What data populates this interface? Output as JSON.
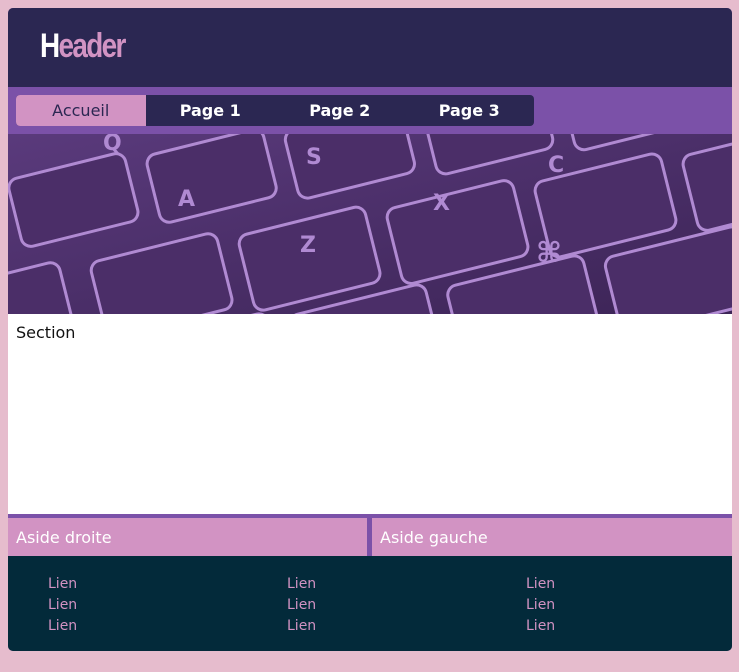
{
  "header": {
    "logo_first": "H",
    "logo_rest": "eader"
  },
  "nav": {
    "items": [
      {
        "label": "Accueil",
        "active": true
      },
      {
        "label": "Page 1",
        "active": false
      },
      {
        "label": "Page 2",
        "active": false
      },
      {
        "label": "Page 3",
        "active": false
      }
    ]
  },
  "hero": {
    "image": "keyboard-photo",
    "keys": [
      "Q",
      "S",
      "C",
      "A",
      "X",
      "Z",
      "⌘"
    ]
  },
  "section": {
    "label": "Section"
  },
  "asides": {
    "left_label": "Aside droite",
    "right_label": "Aside gauche"
  },
  "footer": {
    "columns": [
      [
        "Lien",
        "Lien",
        "Lien"
      ],
      [
        "Lien",
        "Lien",
        "Lien"
      ],
      [
        "Lien",
        "Lien",
        "Lien"
      ]
    ]
  },
  "colors": {
    "page_bg": "#e6bccd",
    "header_bg": "#2b2752",
    "accent_purple": "#7b51a8",
    "pink": "#d293c3",
    "hero_bg": "#4a2d66",
    "footer_bg": "#032a3a"
  }
}
